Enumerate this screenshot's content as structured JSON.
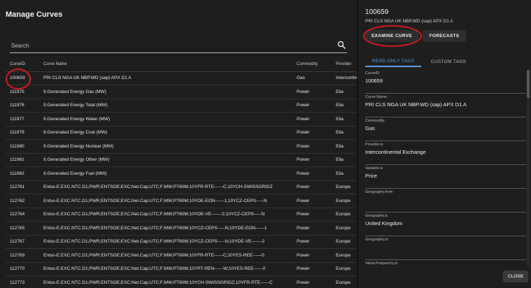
{
  "list_panel": {
    "title": "Manage Curves",
    "search_placeholder": "Search",
    "columns": [
      "CurveID",
      "Curve Name",
      "Commodity",
      "Provider"
    ],
    "rows": [
      {
        "id": "100659",
        "name": "PRI CLS NGA UK NBP.WD (sap) APX D1 A",
        "commodity": "Gas",
        "provider": "Intercontinental Exchange"
      },
      {
        "id": "111975",
        "name": "9.Generated Energy Gas (MW)",
        "commodity": "Power",
        "provider": "Elia"
      },
      {
        "id": "111976",
        "name": "9.Generated Energy Total (MW)",
        "commodity": "Power",
        "provider": "Elia"
      },
      {
        "id": "111977",
        "name": "9.Generated Energy Water (MW)",
        "commodity": "Power",
        "provider": "Elia"
      },
      {
        "id": "111978",
        "name": "9.Generated Energy Coal (MW)",
        "commodity": "Power",
        "provider": "Elia"
      },
      {
        "id": "111980",
        "name": "9.Generated Energy Nuclear (MW)",
        "commodity": "Power",
        "provider": "Elia"
      },
      {
        "id": "111981",
        "name": "9.Generated Energy Other (MW)",
        "commodity": "Power",
        "provider": "Elia"
      },
      {
        "id": "111982",
        "name": "9.Generated Energy Fuel (MW)",
        "commodity": "Power",
        "provider": "Elia"
      },
      {
        "id": "112761",
        "name": "Entso-E.EXC.NTC.D1;PWR;ENTSOE;EXC;Net.Cap;UTC;F;MW;PT60M;10YFR-RTE------C;10YCH-SWISSGRIDZ",
        "commodity": "Power",
        "provider": "Europe"
      },
      {
        "id": "112762",
        "name": "Entso-E.EXC.NTC.D1;PWR;ENTSOE;EXC;Net.Cap;UTC;F;MW;PT60M;10YDE-EON------1;10YCZ-CEPS-----N",
        "commodity": "Power",
        "provider": "Europe"
      },
      {
        "id": "112764",
        "name": "Entso-E.EXC.NTC.D1;PWR;ENTSOE;EXC;Net.Cap;UTC;F;MW;PT60M;10YDE-VE-------2;10YCZ-CEPS-----N",
        "commodity": "Power",
        "provider": "Europe"
      },
      {
        "id": "112765",
        "name": "Entso-E.EXC.NTC.D1;PWR;ENTSOE;EXC;Net.Cap;UTC;F;MW;PT60M;10YCZ-CEPS-----N;10YDE-EON------1",
        "commodity": "Power",
        "provider": "Europe"
      },
      {
        "id": "112767",
        "name": "Entso-E.EXC.NTC.D1;PWR;ENTSOE;EXC;Net.Cap;UTC;F;MW;PT60M;10YCZ-CEPS-----N;10YDE-VE-------2",
        "commodity": "Power",
        "provider": "Europe"
      },
      {
        "id": "112769",
        "name": "Entso-E.EXC.NTC.D1;PWR;ENTSOE;EXC;Net.Cap;UTC;F;MW;PT60M;10YFR-RTE------C;10YES-REE------0",
        "commodity": "Power",
        "provider": "Europe"
      },
      {
        "id": "112770",
        "name": "Entso-E.EXC.NTC.D1;PWR;ENTSOE;EXC;Net.Cap;UTC;F;MW;PT60M;10YPT-REN------W;10YES-REE------0",
        "commodity": "Power",
        "provider": "Europe"
      },
      {
        "id": "112773",
        "name": "Entso-E.EXC.NTC.D1;PWR;ENTSOE;EXC;Net.Cap;UTC;F;MW;PT60M;10YCH-SWISSGRIDZ;10YFR-RTE------C",
        "commodity": "Power",
        "provider": "Europe"
      }
    ]
  },
  "detail_panel": {
    "title": "100659",
    "subtitle": "PRI CLS NGA UK NBP.WD (sap) APX D1 A",
    "examine_label": "EXAMINE CURVE",
    "forecasts_label": "FORECASTS",
    "tab_readonly": "READ-ONLY TAGS",
    "tab_custom": "CUSTOM TAGS",
    "fields": [
      {
        "label": "CurveID",
        "value": "100659"
      },
      {
        "label": "Curve Name",
        "value": "PRI CLS NGA UK NBP.WD (sap) APX D1 A"
      },
      {
        "label": "Commodity",
        "value": "Gas"
      },
      {
        "label": "Provider.is",
        "value": "Intercontinental Exchange"
      },
      {
        "label": "Variable.is",
        "value": "Price"
      },
      {
        "label": "Geography.from",
        "value": ""
      },
      {
        "label": "Geography.is",
        "value": "United Kingdom"
      },
      {
        "label": "Geography.to",
        "value": ""
      },
      {
        "label": "Value.Frequency.is",
        "value": ""
      }
    ]
  },
  "close_label": "CLOSE",
  "colors": {
    "accent": "#5aa0e6",
    "highlight_marker": "#d7191c"
  }
}
